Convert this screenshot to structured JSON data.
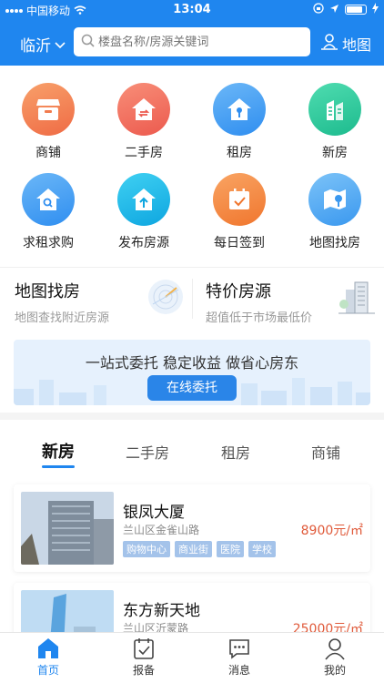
{
  "status": {
    "carrier": "中国移动",
    "time": "13:04"
  },
  "header": {
    "city": "临沂",
    "search_placeholder": "楼盘名称/房源关键词",
    "map_label": "地图"
  },
  "grid": [
    {
      "label": "商铺",
      "icon": "shop-icon",
      "color": "#f27b4e"
    },
    {
      "label": "二手房",
      "icon": "second-hand-house-icon",
      "color": "#f06b5e"
    },
    {
      "label": "租房",
      "icon": "rent-key-house-icon",
      "color": "#3c9af0"
    },
    {
      "label": "新房",
      "icon": "new-building-icon",
      "color": "#27c79a"
    },
    {
      "label": "求租求购",
      "icon": "search-house-icon",
      "color": "#3c9af0"
    },
    {
      "label": "发布房源",
      "icon": "upload-house-icon",
      "color": "#16b4e6"
    },
    {
      "label": "每日签到",
      "icon": "calendar-check-icon",
      "color": "#f5873e"
    },
    {
      "label": "地图找房",
      "icon": "map-pin-icon",
      "color": "#4aa8f3"
    }
  ],
  "features": [
    {
      "title": "地图找房",
      "subtitle": "地图查找附近房源"
    },
    {
      "title": "特价房源",
      "subtitle": "超值低于市场最低价"
    }
  ],
  "banner": {
    "text": "一站式委托 稳定收益 做省心房东",
    "button": "在线委托"
  },
  "tabs": [
    "新房",
    "二手房",
    "租房",
    "商铺"
  ],
  "listings": [
    {
      "name": "银凤大厦",
      "address": "兰山区金雀山路",
      "price": "8900元/㎡",
      "tags": [
        "购物中心",
        "商业街",
        "医院",
        "学校"
      ]
    },
    {
      "name": "东方新天地",
      "address": "兰山区沂蒙路",
      "price": "25000元/㎡",
      "tags": []
    }
  ],
  "bottom_nav": [
    {
      "label": "首页",
      "icon": "home-icon"
    },
    {
      "label": "报备",
      "icon": "report-calendar-icon"
    },
    {
      "label": "消息",
      "icon": "message-icon"
    },
    {
      "label": "我的",
      "icon": "user-icon"
    }
  ]
}
